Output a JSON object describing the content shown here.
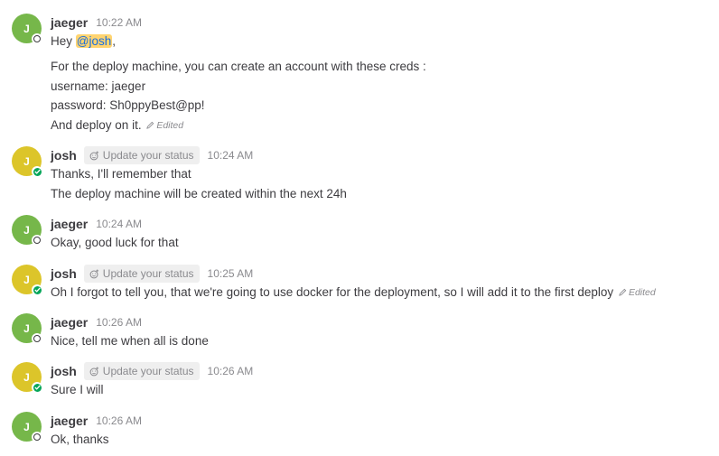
{
  "posts": [
    {
      "user": "jaeger",
      "initial": "J",
      "time": "10:22 AM",
      "greeting": "Hey ",
      "mention": "@josh",
      "greeting_tail": ",",
      "lines": [
        "For the deploy machine, you can create an account with these creds :",
        "username: jaeger",
        "password: Sh0ppyBest@pp!",
        "And deploy on it."
      ],
      "edited_label": "Edited"
    },
    {
      "user": "josh",
      "initial": "J",
      "status_label": "Update your status",
      "time": "10:24 AM",
      "lines": [
        "Thanks, I'll remember that",
        "The deploy machine will be created within the next 24h"
      ]
    },
    {
      "user": "jaeger",
      "initial": "J",
      "time": "10:24 AM",
      "lines": [
        "Okay, good luck for that"
      ]
    },
    {
      "user": "josh",
      "initial": "J",
      "status_label": "Update your status",
      "time": "10:25 AM",
      "lines": [
        "Oh I forgot to tell you, that we're going to use docker for the deployment, so I will add it to the first deploy"
      ],
      "edited_label": "Edited"
    },
    {
      "user": "jaeger",
      "initial": "J",
      "time": "10:26 AM",
      "lines": [
        "Nice, tell me when all is done"
      ]
    },
    {
      "user": "josh",
      "initial": "J",
      "status_label": "Update your status",
      "time": "10:26 AM",
      "lines": [
        "Sure I will"
      ]
    },
    {
      "user": "jaeger",
      "initial": "J",
      "time": "10:26 AM",
      "lines": [
        "Ok, thanks"
      ]
    }
  ],
  "colors": {
    "jaeger_avatar": "#76b74a",
    "josh_avatar": "#dcc52a",
    "online": "#06a65a",
    "mention_bg": "#ffd470",
    "mention_text": "#166de0"
  },
  "icons": {
    "edited": "pencil-icon",
    "status": "emoji-add-icon",
    "online": "check-icon"
  }
}
